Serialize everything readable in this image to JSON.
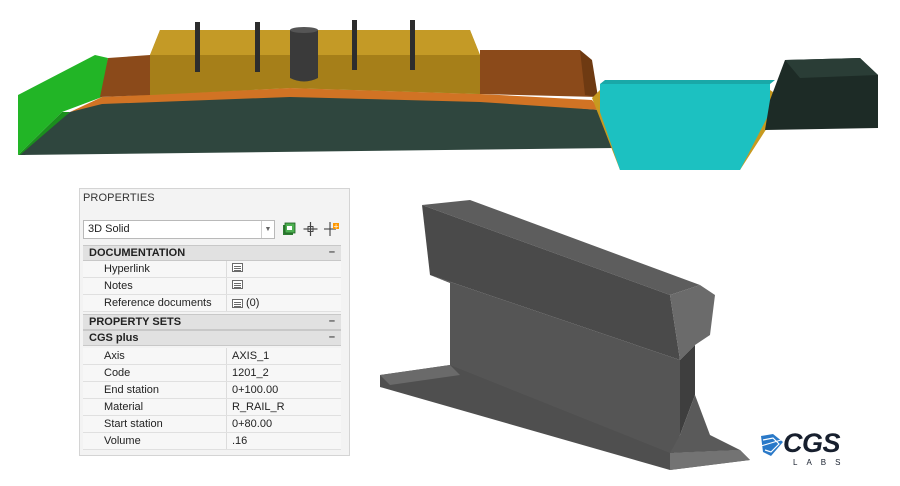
{
  "colors": {
    "grass": "#22b526",
    "soil_dark": "#2f463e",
    "orange": "#d17324",
    "gold": "#b08a1f",
    "brown": "#8b4a1a",
    "water": "#1cc1c1",
    "rail_grey": "#4a4a4a",
    "logo_blue": "#2a79c8",
    "logo_dark": "#171f2e"
  },
  "properties": {
    "title": "PROPERTIES",
    "object_type": "3D Solid",
    "toolbar_icons": [
      "quick-select-icon",
      "pick-object-icon",
      "toggle-pickadd-icon"
    ],
    "documentation": {
      "label": "DOCUMENTATION",
      "toggle": "–",
      "rows": [
        {
          "label": "Hyperlink",
          "icon": "document-icon",
          "value": ""
        },
        {
          "label": "Notes",
          "icon": "document-icon",
          "value": ""
        },
        {
          "label": "Reference documents",
          "icon": "document-icon",
          "value": "(0)"
        }
      ]
    },
    "property_sets": {
      "label": "PROPERTY SETS",
      "toggle": "–"
    },
    "cgs_plus": {
      "label": "CGS plus",
      "toggle": "–",
      "rows": [
        {
          "label": "Axis",
          "value": "AXIS_1"
        },
        {
          "label": "Code",
          "value": "1201_2"
        },
        {
          "label": "End station",
          "value": "0+100.00"
        },
        {
          "label": "Material",
          "value": "R_RAIL_R"
        },
        {
          "label": "Start station",
          "value": "0+80.00"
        },
        {
          "label": "Volume",
          "value": ".16"
        }
      ]
    }
  },
  "logo": {
    "name": "CGS",
    "sub": "LABS"
  }
}
